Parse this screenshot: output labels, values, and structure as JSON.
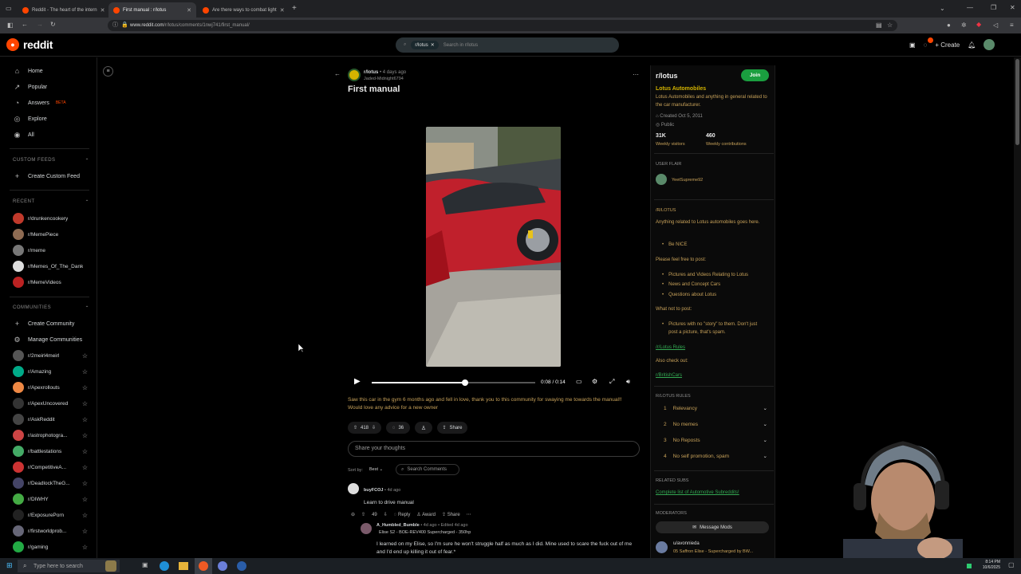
{
  "browser": {
    "tabs": [
      {
        "title": "Reddit - The heart of the intern",
        "active": false
      },
      {
        "title": "First manual : r/lotus",
        "active": true
      },
      {
        "title": "Are there ways to combat light",
        "active": false
      }
    ],
    "url_host": "www.reddit.com",
    "url_path": "/r/lotus/comments/1nwj741/first_manual/"
  },
  "header": {
    "logo_text": "reddit",
    "search_chip": "r/lotus",
    "search_placeholder": "Search in r/lotus",
    "create_label": "Create"
  },
  "sidebar": {
    "nav": [
      {
        "label": "Home",
        "icon": "home-icon"
      },
      {
        "label": "Popular",
        "icon": "popular-icon"
      },
      {
        "label": "Answers",
        "badge": "BETA",
        "icon": "answers-icon"
      },
      {
        "label": "Explore",
        "icon": "explore-icon"
      },
      {
        "label": "All",
        "icon": "all-icon"
      }
    ],
    "custom_feeds_title": "CUSTOM FEEDS",
    "create_custom_feed": "Create Custom Feed",
    "recent_title": "RECENT",
    "recent": [
      "r/drunkencookery",
      "r/MemePiece",
      "r/meme",
      "r/Memes_Of_The_Dank",
      "r/MemeVideos"
    ],
    "communities_title": "COMMUNITIES",
    "create_community": "Create Community",
    "manage_communities": "Manage Communities",
    "communities": [
      "r/2meirl4meirl",
      "r/Amazing",
      "r/Apexrollouts",
      "r/ApexUncovered",
      "r/AskReddit",
      "r/astrophotogra...",
      "r/battlestations",
      "r/CompetitiveA...",
      "r/DeadlockTheG...",
      "r/DIWHY",
      "r/ExposurePorn",
      "r/firstworldprob...",
      "r/gaming"
    ]
  },
  "post": {
    "subreddit": "r/lotus",
    "age": "• 4 days ago",
    "author": "Jaded-Midnight6794",
    "title": "First manual",
    "video_time": "0:08 / 0:14",
    "video_progress": 0.571,
    "body": "Saw this car in the gym 6 months ago and fell in love, thank you to this community for swaying me towards the manual!! Would love any advice for a new owner",
    "votes": "418",
    "comments": "36",
    "share_label": "Share",
    "comment_placeholder": "Share your thoughts",
    "sort_label": "Sort by:",
    "sort_value": "Best",
    "search_comments": "Search Comments"
  },
  "comments": [
    {
      "author": "buyFCOJ",
      "age": "• 4d ago",
      "text": "Learn to drive manual",
      "votes": "49",
      "reply": "Reply",
      "award": "Award",
      "share": "Share"
    },
    {
      "author": "A_Humbled_Bumble",
      "age": "• 4d ago • Edited 4d ago",
      "flair": "Elise S2 - BOE-REV400 Supercharged - 350hp",
      "text": "I learned on my Elise, so I'm sure he won't struggle half as much as I did. Mine used to scare the fuck out of me and I'd end up killing it out of fear.*"
    }
  ],
  "right": {
    "sub_name": "r/lotus",
    "join": "Join",
    "about_title": "Lotus Automobiles",
    "about_desc": "Lotus Automobiles and anything in general related to the car manufacturer.",
    "created": "Created Oct 5, 2011",
    "visibility": "Public",
    "weekly_visitors": "31K",
    "weekly_visitors_label": "Weekly visitors",
    "weekly_contrib": "460",
    "weekly_contrib_label": "Weekly contributions",
    "user_flair_title": "USER FLAIR",
    "user_flair_name": "YeetSupreme92",
    "rlotus_title": "/R/LOTUS",
    "intro": "Anything related to Lotus automobiles goes here.",
    "be_nice": "Be NICE",
    "feel_free": "Please feel free to post:",
    "post_items": [
      "Pictures and Videos Relating to Lotus",
      "News and Concept Cars",
      "Questions about Lotus"
    ],
    "not_post_title": "What not to post:",
    "not_post_item": "Pictures with no \"story\" to them. Don't just post a picture, that's spam.",
    "rules_link": "/r/Lotus Rules",
    "also_check": "Also check out:",
    "british_link": "r/BritishCars",
    "rules_title": "R/LOTUS RULES",
    "rules": [
      {
        "n": "1",
        "t": "Relevancy"
      },
      {
        "n": "2",
        "t": "No memes"
      },
      {
        "n": "3",
        "t": "No Reposts"
      },
      {
        "n": "4",
        "t": "No self promotion, spam"
      }
    ],
    "related_title": "RELATED SUBS",
    "related_link": "Complete list of Automotive Subreddits!",
    "mods_title": "MODERATORS",
    "message_mods": "Message Mods",
    "mod_name": "u/avonnieda",
    "mod_flair": "05 Saffron Elise - Supercharged by BW..."
  },
  "taskbar": {
    "search_placeholder": "Type here to search",
    "time": "8:14 PM",
    "date": "10/6/2025"
  },
  "colors": {
    "accent": "#ff4500",
    "join": "#1a9e3f",
    "gold": "#c8a25a",
    "link": "#33a852"
  }
}
